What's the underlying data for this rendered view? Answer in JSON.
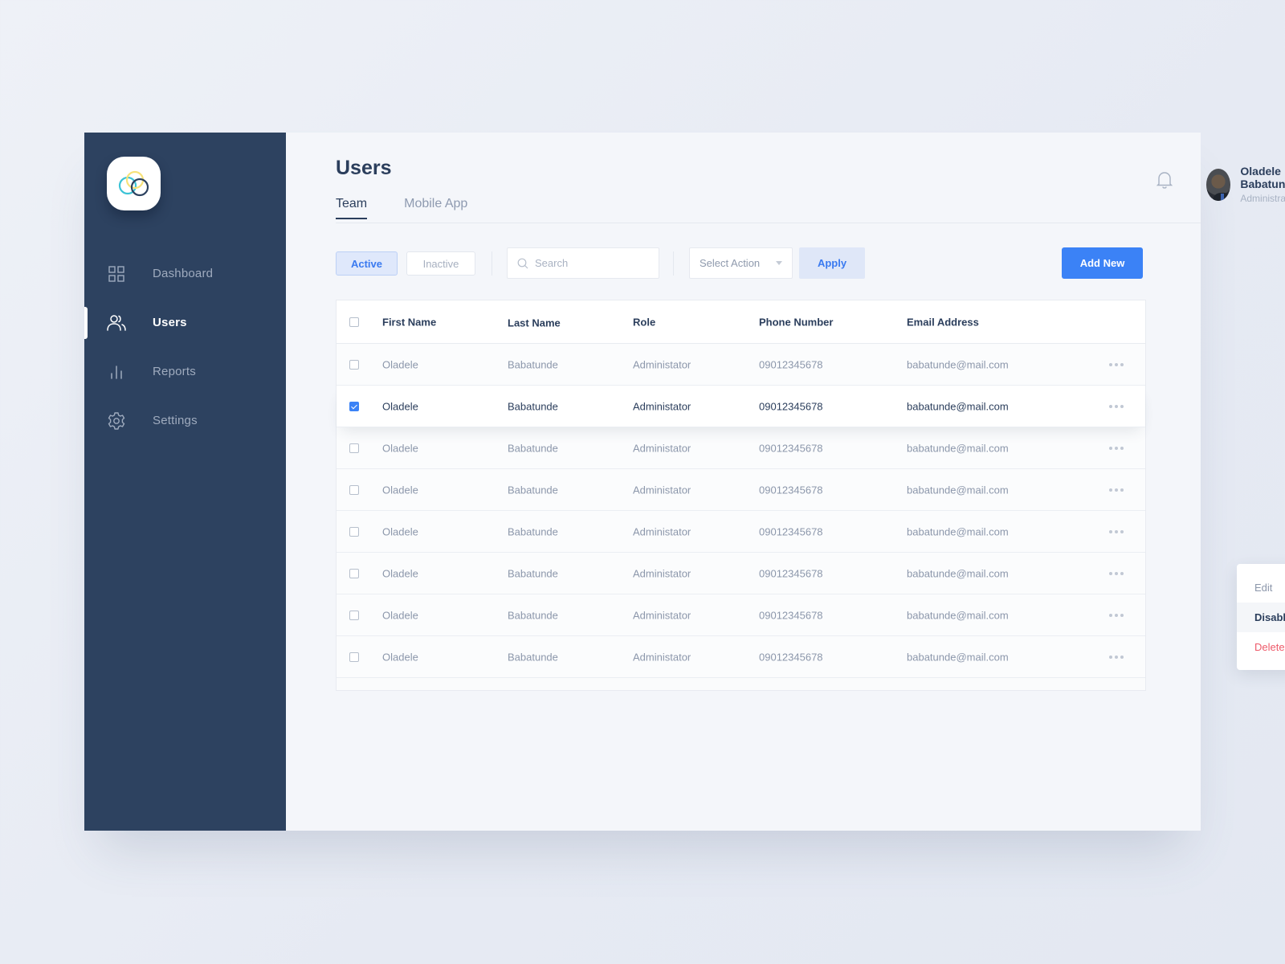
{
  "app": {
    "logo": "overlapping-rings-logo"
  },
  "sidebar": {
    "items": [
      {
        "label": "Dashboard",
        "icon": "grid-icon",
        "active": false
      },
      {
        "label": "Users",
        "icon": "users-icon",
        "active": true
      },
      {
        "label": "Reports",
        "icon": "bar-chart-icon",
        "active": false
      },
      {
        "label": "Settings",
        "icon": "gear-icon",
        "active": false
      }
    ]
  },
  "header": {
    "title": "Users",
    "tabs": [
      {
        "label": "Team",
        "active": true
      },
      {
        "label": "Mobile App",
        "active": false
      }
    ],
    "notification_icon": "bell-icon",
    "user": {
      "name": "Oladele Babatunde",
      "role": "Administrator"
    }
  },
  "toolbar": {
    "filter_active": "Active",
    "filter_inactive": "Inactive",
    "search_placeholder": "Search",
    "search_value": "",
    "select_action": "Select Action",
    "apply": "Apply",
    "add_new": "Add New"
  },
  "table": {
    "columns": [
      "First Name",
      "Last Name",
      "Role",
      "Phone Number",
      "Email Address"
    ],
    "rows": [
      {
        "first": "Oladele",
        "last": "Babatunde",
        "role": "Administator",
        "phone": "09012345678",
        "email": "babatunde@mail.com",
        "checked": false
      },
      {
        "first": "Oladele",
        "last": "Babatunde",
        "role": "Administator",
        "phone": "09012345678",
        "email": "babatunde@mail.com",
        "checked": true
      },
      {
        "first": "Oladele",
        "last": "Babatunde",
        "role": "Administator",
        "phone": "09012345678",
        "email": "babatunde@mail.com",
        "checked": false
      },
      {
        "first": "Oladele",
        "last": "Babatunde",
        "role": "Administator",
        "phone": "09012345678",
        "email": "babatunde@mail.com",
        "checked": false
      },
      {
        "first": "Oladele",
        "last": "Babatunde",
        "role": "Administator",
        "phone": "09012345678",
        "email": "babatunde@mail.com",
        "checked": false
      },
      {
        "first": "Oladele",
        "last": "Babatunde",
        "role": "Administator",
        "phone": "09012345678",
        "email": "babatunde@mail.com",
        "checked": false
      },
      {
        "first": "Oladele",
        "last": "Babatunde",
        "role": "Administator",
        "phone": "09012345678",
        "email": "babatunde@mail.com",
        "checked": false
      },
      {
        "first": "Oladele",
        "last": "Babatunde",
        "role": "Administator",
        "phone": "09012345678",
        "email": "babatunde@mail.com",
        "checked": false
      }
    ]
  },
  "context_menu": {
    "items": [
      {
        "label": "Edit"
      },
      {
        "label": "Disable"
      },
      {
        "label": "Delete"
      }
    ]
  },
  "colors": {
    "sidebar": "#2d4260",
    "accent": "#3b82f6",
    "danger": "#ee5a6a",
    "text_primary": "#2b3e5c",
    "text_muted": "#8c97ab"
  }
}
